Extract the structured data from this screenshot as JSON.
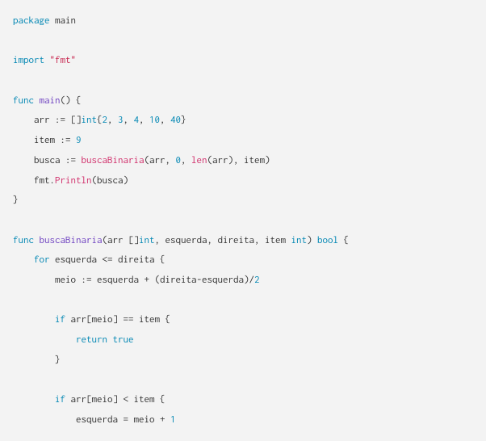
{
  "code": {
    "l1_package": "package",
    "l1_main": "main",
    "l2_import": "import",
    "l2_fmt": "\"fmt\"",
    "l3_func": "func",
    "l3_main": "main",
    "l3_parens": "()",
    "l3_brace": " {",
    "l4": "    arr ",
    "l4_op": ":=",
    "l4_b": " []",
    "l4_int": "int",
    "l4_vals": "{2, 3, 4, 10, 40}",
    "l4_n1": "2",
    "l4_n2": "3",
    "l4_n3": "4",
    "l4_n4": "10",
    "l4_n5": "40",
    "l5_a": "    item ",
    "l5_op": ":=",
    "l5_sp": " ",
    "l5_n": "9",
    "l6_a": "    busca ",
    "l6_op": ":=",
    "l6_sp": " ",
    "l6_fn": "buscaBinaria",
    "l6_p1": "(arr, ",
    "l6_n0": "0",
    "l6_p2": ", ",
    "l6_len": "len",
    "l6_p3": "(arr), item)",
    "l7_a": "    fmt.",
    "l7_fn": "Println",
    "l7_p": "(busca)",
    "l8": "}",
    "l9_func": "func",
    "l9_sp": " ",
    "l9_fn": "buscaBinaria",
    "l9_sig1": "(arr []",
    "l9_int1": "int",
    "l9_sig2": ", esquerda, direita, item ",
    "l9_int2": "int",
    "l9_sig3": ") ",
    "l9_bool": "bool",
    "l9_brace": " {",
    "l10_a": "    ",
    "l10_for": "for",
    "l10_b": " esquerda ",
    "l10_op": "<=",
    "l10_c": " direita {",
    "l11_a": "        meio ",
    "l11_op": ":=",
    "l11_b": " esquerda ",
    "l11_plus": "+",
    "l11_c": " (direita",
    "l11_minus": "-",
    "l11_d": "esquerda)",
    "l11_div": "/",
    "l11_n": "2",
    "l12_a": "        ",
    "l12_if": "if",
    "l12_b": " arr[meio] ",
    "l12_op": "==",
    "l12_c": " item {",
    "l13_a": "            ",
    "l13_ret": "return",
    "l13_sp": " ",
    "l13_true": "true",
    "l14": "        }",
    "l15_a": "        ",
    "l15_if": "if",
    "l15_b": " arr[meio] ",
    "l15_op": "<",
    "l15_c": " item {",
    "l16_a": "            esquerda ",
    "l16_op": "=",
    "l16_b": " meio ",
    "l16_plus": "+",
    "l16_sp": " ",
    "l16_n": "1"
  }
}
